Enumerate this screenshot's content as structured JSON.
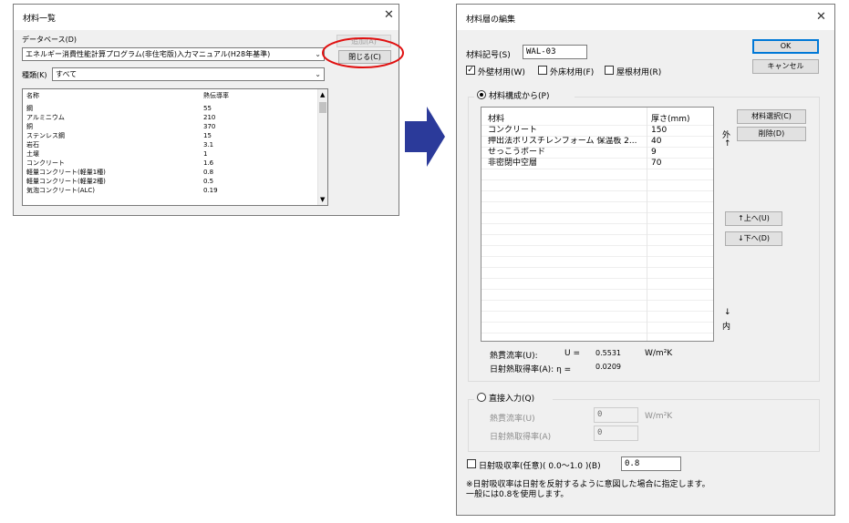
{
  "left_dialog": {
    "title": "材料一覧",
    "database_label": "データベース(D)",
    "database_value": "エネルギー消費性能計算プログラム(非住宅版)入力マニュアル(H28年基準)",
    "add_button": "追加(A)",
    "close_button": "閉じる(C)",
    "category_label": "種類(K)",
    "category_value": "すべて",
    "columns": [
      "名称",
      "熱伝導率"
    ],
    "rows": [
      [
        "鋼",
        "55"
      ],
      [
        "アルミニウム",
        "210"
      ],
      [
        "銅",
        "370"
      ],
      [
        "ステンレス鋼",
        "15"
      ],
      [
        "岩石",
        "3.1"
      ],
      [
        "土壌",
        "1"
      ],
      [
        "コンクリート",
        "1.6"
      ],
      [
        "軽量コンクリート(軽量1種)",
        "0.8"
      ],
      [
        "軽量コンクリート(軽量2種)",
        "0.5"
      ],
      [
        "気泡コンクリート(ALC)",
        "0.19"
      ]
    ]
  },
  "right_dialog": {
    "title": "材料層の編集",
    "code_label": "材料記号(S)",
    "code_value": "WAL-03",
    "ok_button": "OK",
    "cancel_button": "キャンセル",
    "checkboxes": [
      {
        "label": "外壁材用(W)",
        "checked": true
      },
      {
        "label": "外床材用(F)",
        "checked": false
      },
      {
        "label": "屋根材用(R)",
        "checked": false
      }
    ],
    "composition_radio": "材料構成から(P)",
    "grid_headers": [
      "材料",
      "厚さ(mm)"
    ],
    "grid_rows": [
      [
        "コンクリート",
        "150"
      ],
      [
        "押出法ポリスチレンフォーム 保温板 2...",
        "40"
      ],
      [
        "せっこうボード",
        "9"
      ],
      [
        "非密閉中空層",
        "70"
      ]
    ],
    "select_material_button": "材料選択(C)",
    "delete_button": "削除(D)",
    "outside_label": "外",
    "inside_label": "内",
    "up_arrow": "↑",
    "down_arrow": "↓",
    "move_up_button": "↑上へ(U)",
    "move_down_button": "↓下へ(D)",
    "u_label": "熱貫流率(U):",
    "u_symbol": "U =",
    "u_value": "0.5531",
    "u_unit": "W/m²K",
    "eta_label": "日射熱取得率(A): η =",
    "eta_value": "0.0209",
    "direct_radio": "直接入力(Q)",
    "direct_u_label": "熱貫流率(U)",
    "direct_u_value": "0",
    "direct_u_unit": "W/m²K",
    "direct_eta_label": "日射熱取得率(A)",
    "direct_eta_value": "0",
    "absorption_label": "日射吸収率(任意)( 0.0～1.0 )(B)",
    "absorption_value": "0.8",
    "note_line1": "※日射吸収率は日射を反射するように意図した場合に指定します。",
    "note_line2": "一般には0.8を使用します。"
  },
  "colors": {
    "arrow": "#2b3a9a",
    "highlight_circle": "#e01010",
    "accent": "#0078d7"
  }
}
